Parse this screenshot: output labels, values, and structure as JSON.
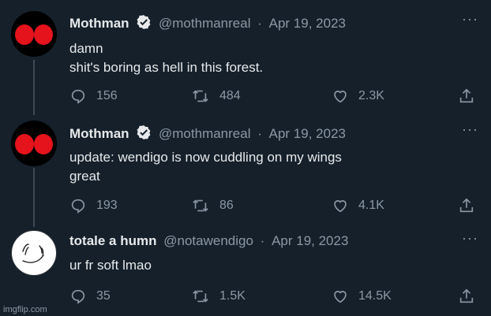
{
  "tweets": [
    {
      "name": "Mothman",
      "handle": "@mothmanreal",
      "date": "Apr 19, 2023",
      "verified": true,
      "lines": [
        "damn",
        "shit's boring as hell in this forest."
      ],
      "replies": "156",
      "retweets": "484",
      "likes": "2.3K",
      "avatar": "red-eyes"
    },
    {
      "name": "Mothman",
      "handle": "@mothmanreal",
      "date": "Apr 19, 2023",
      "verified": true,
      "lines": [
        "update: wendigo is now cuddling on my wings",
        "great"
      ],
      "replies": "193",
      "retweets": "86",
      "likes": "4.1K",
      "avatar": "red-eyes"
    },
    {
      "name": "totale a humn",
      "handle": "@notawendigo",
      "date": "Apr 19, 2023",
      "verified": false,
      "lines": [
        "ur fr soft lmao"
      ],
      "replies": "35",
      "retweets": "1.5K",
      "likes": "14.5K",
      "avatar": "white-sketch"
    }
  ],
  "separator": "·",
  "more_glyph": "···",
  "watermark": "imgflip.com",
  "colors": {
    "background": "#15202b",
    "text": "#e7e9ea",
    "muted": "#8b98a5",
    "eye_red": "#e5131b"
  },
  "icons": [
    "verified-badge-icon",
    "reply-icon",
    "retweet-icon",
    "like-icon",
    "share-icon",
    "more-icon"
  ]
}
